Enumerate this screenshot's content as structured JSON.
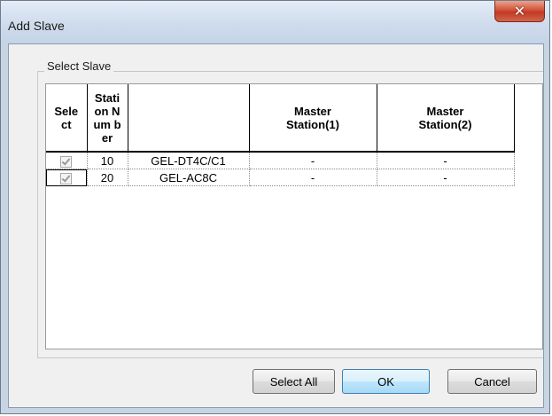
{
  "window": {
    "title": "Add Slave",
    "close_glyph": "✕"
  },
  "group": {
    "label": "Select Slave"
  },
  "grid": {
    "headers": {
      "select": "Sele ct",
      "station": "Stati on Num ber",
      "name": "",
      "master1": "Master Station(1)",
      "master2": "Master Station(2)"
    },
    "rows": [
      {
        "selected": true,
        "station": "10",
        "name": "GEL-DT4C/C1",
        "master1": "-",
        "master2": "-"
      },
      {
        "selected": true,
        "station": "20",
        "name": "GEL-AC8C",
        "master1": "-",
        "master2": "-"
      }
    ]
  },
  "buttons": {
    "select_all": "Select All",
    "ok": "OK",
    "cancel": "Cancel"
  }
}
